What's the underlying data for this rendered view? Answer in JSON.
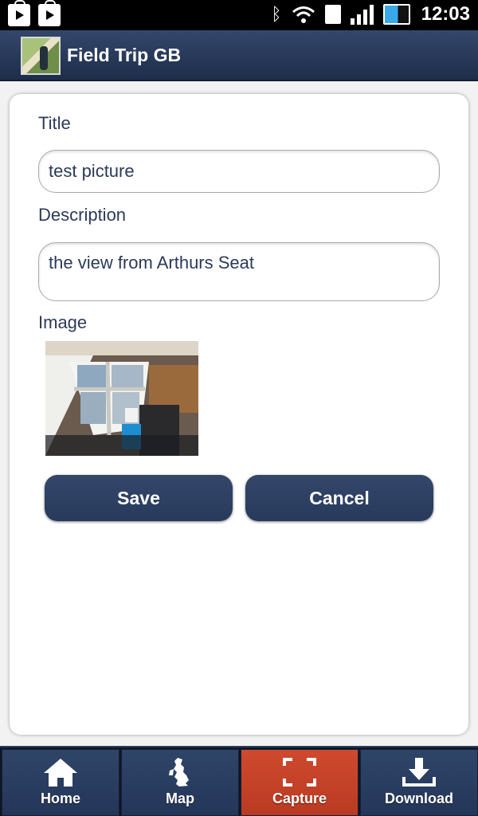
{
  "status_bar": {
    "time": "12:03",
    "left_icons": [
      "play-store-icon",
      "play-store-icon"
    ],
    "right_icons": [
      "bluetooth-icon",
      "wifi-icon",
      "sim-icon",
      "signal-icon",
      "battery-icon"
    ]
  },
  "header": {
    "app_title": "Field Trip GB",
    "logo_icon": "app-logo"
  },
  "form": {
    "title_label": "Title",
    "title_value": "test picture",
    "description_label": "Description",
    "description_value": "the view from Arthurs Seat",
    "image_label": "Image",
    "save_label": "Save",
    "cancel_label": "Cancel"
  },
  "tabs": [
    {
      "label": "Home",
      "icon": "home-icon"
    },
    {
      "label": "Map",
      "icon": "map-icon"
    },
    {
      "label": "Capture",
      "icon": "capture-icon",
      "active": true
    },
    {
      "label": "Download",
      "icon": "download-icon"
    }
  ],
  "colors": {
    "header": "#2b3d5f",
    "accent_active": "#c7432a",
    "button": "#2f4163",
    "label_text": "#2c3a58"
  }
}
